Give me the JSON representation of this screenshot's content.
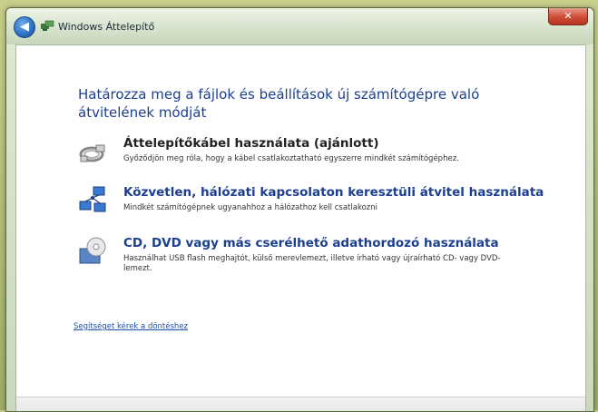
{
  "window": {
    "title": "Windows Áttelepítő"
  },
  "main": {
    "heading": "Határozza meg a fájlok és beállítások új számítógépre való átvitelének módját",
    "options": [
      {
        "label": "Áttelepítőkábel használata (ajánlott)",
        "description": "Győződjön meg róla, hogy a kábel csatlakoztatható egyszerre mindkét számítógéphez.",
        "icon": "cable-icon"
      },
      {
        "label": "Közvetlen, hálózati kapcsolaton keresztüli átvitel használata",
        "description": "Mindkét számítógépnek ugyanahhoz a hálózathoz kell csatlakozni",
        "icon": "network-icon"
      },
      {
        "label": "CD, DVD vagy más cserélhető adathordozó használata",
        "description": "Használhat USB flash meghajtót, külső merevlemezt, illetve írható vagy újraírható CD- vagy DVD-lemezt.",
        "icon": "disc-drive-icon"
      }
    ],
    "help_link": "Segítséget kérek a döntéshez"
  },
  "colors": {
    "heading_blue": "#1c3f8f",
    "link_blue": "#1c4fa8",
    "close_red": "#d0513d"
  }
}
